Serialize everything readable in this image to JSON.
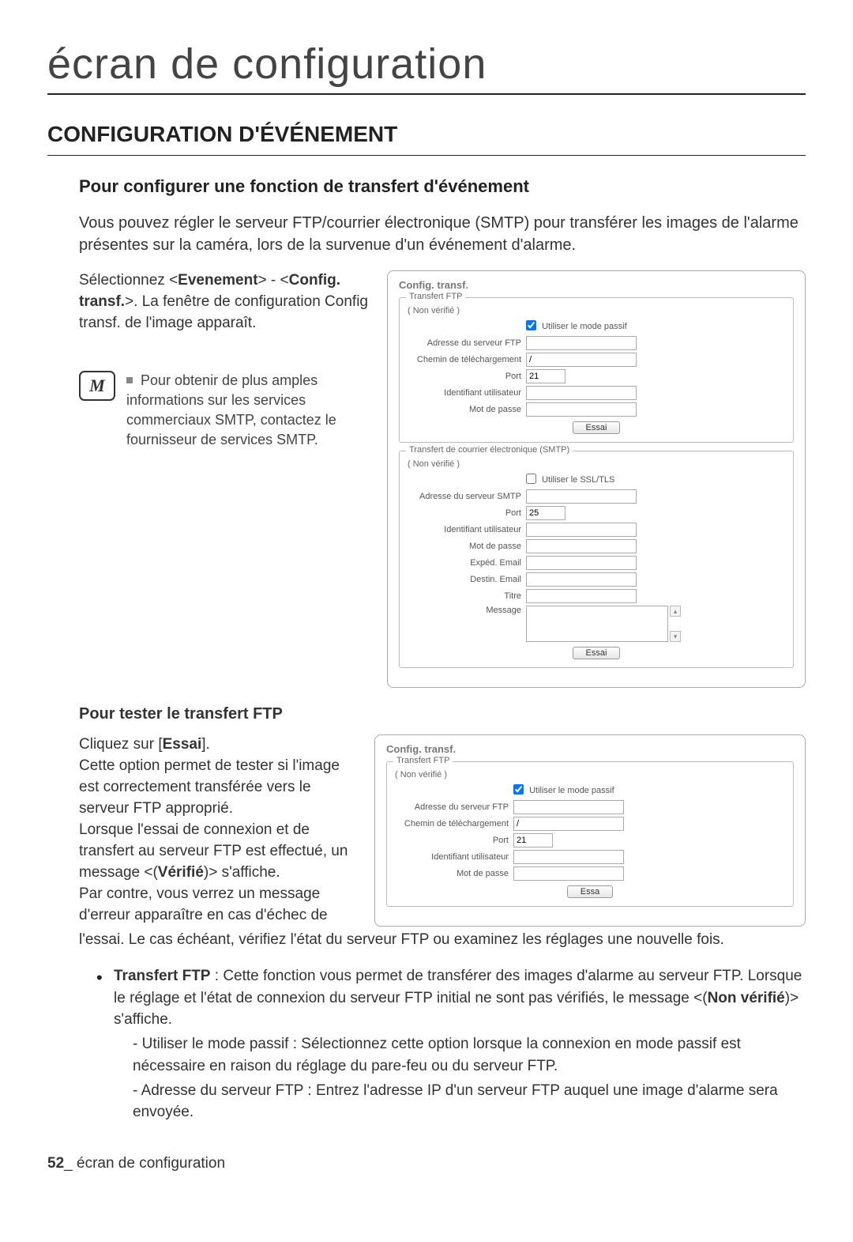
{
  "page_title": "écran de configuration",
  "section_title": "CONFIGURATION D'ÉVÉNEMENT",
  "sub_title": "Pour configurer une fonction de transfert d'événement",
  "intro": "Vous pouvez régler le serveur FTP/courrier électronique (SMTP) pour transférer les images de l'alarme présentes sur la caméra, lors de la survenue d'un événement d'alarme.",
  "select_pre": "Sélectionnez <",
  "select_b1": "Evenement",
  "select_mid": "> - <",
  "select_b2": "Config. transf.",
  "select_post": ">. La fenêtre de configuration Config transf. de l'image apparaît.",
  "note_icon": "M",
  "note_text": "Pour obtenir de plus amples informations sur les services commerciaux SMTP, contactez le fournisseur de services SMTP.",
  "dialog1": {
    "title": "Config. transf.",
    "ftp": {
      "legend": "Transfert FTP",
      "status": "( Non vérifié )",
      "passive_label": "Utiliser le mode passif",
      "passive_checked": true,
      "addr_label": "Adresse du serveur FTP",
      "path_label": "Chemin de téléchargement",
      "path_value": "/",
      "port_label": "Port",
      "port_value": "21",
      "user_label": "Identifiant utilisateur",
      "pass_label": "Mot de passe",
      "test_btn": "Essai"
    },
    "smtp": {
      "legend": "Transfert de courrier électronique (SMTP)",
      "status": "( Non vérifié )",
      "ssl_label": "Utiliser le SSL/TLS",
      "ssl_checked": false,
      "addr_label": "Adresse du serveur SMTP",
      "port_label": "Port",
      "port_value": "25",
      "user_label": "Identifiant utilisateur",
      "pass_label": "Mot de passe",
      "from_label": "Expéd. Email",
      "to_label": "Destin. Email",
      "title_label": "Titre",
      "msg_label": "Message",
      "test_btn": "Essai"
    }
  },
  "sub_h3": "Pour tester le transfert FTP",
  "test_p1a": "Cliquez sur [",
  "test_p1b": "Essai",
  "test_p1c": "].",
  "test_p2": "Cette option permet de tester si l'image est correctement transférée vers le serveur FTP approprié.",
  "test_p3a": "Lorsque l'essai de connexion et de transfert au serveur FTP est effectué, un message <(",
  "test_p3b": "Vérifié",
  "test_p3c": ")> s'affiche.",
  "test_p4": "Par contre, vous verrez un message d'erreur apparaître en cas d'échec de",
  "test_after": "l'essai. Le cas échéant, vérifiez l'état du serveur FTP ou examinez les réglages une nouvelle fois.",
  "dialog2": {
    "title": "Config. transf.",
    "ftp": {
      "legend": "Transfert FTP",
      "status": "( Non vérifié )",
      "passive_label": "Utiliser le mode passif",
      "passive_checked": true,
      "addr_label": "Adresse du serveur FTP",
      "path_label": "Chemin de téléchargement",
      "path_value": "/",
      "port_label": "Port",
      "port_value": "21",
      "user_label": "Identifiant utilisateur",
      "pass_label": "Mot de passe",
      "test_btn": "Essa"
    }
  },
  "bullet1_pre": "Transfert FTP",
  "bullet1_mid": " : Cette fonction vous permet de transférer des images d'alarme au serveur FTP. Lorsque le réglage et l'état de connexion du serveur FTP initial ne sont pas vérifiés, le message <(",
  "bullet1_b": "Non vérifié",
  "bullet1_post": ")> s'affiche.",
  "dash1": "Utiliser le mode passif : Sélectionnez cette option lorsque la connexion en mode passif est nécessaire en raison du réglage du pare-feu ou du serveur FTP.",
  "dash2": "Adresse du serveur FTP : Entrez l'adresse IP d'un serveur FTP auquel une image d'alarme sera envoyée.",
  "footer_num": "52",
  "footer_sep": "_ ",
  "footer_text": "écran de configuration"
}
